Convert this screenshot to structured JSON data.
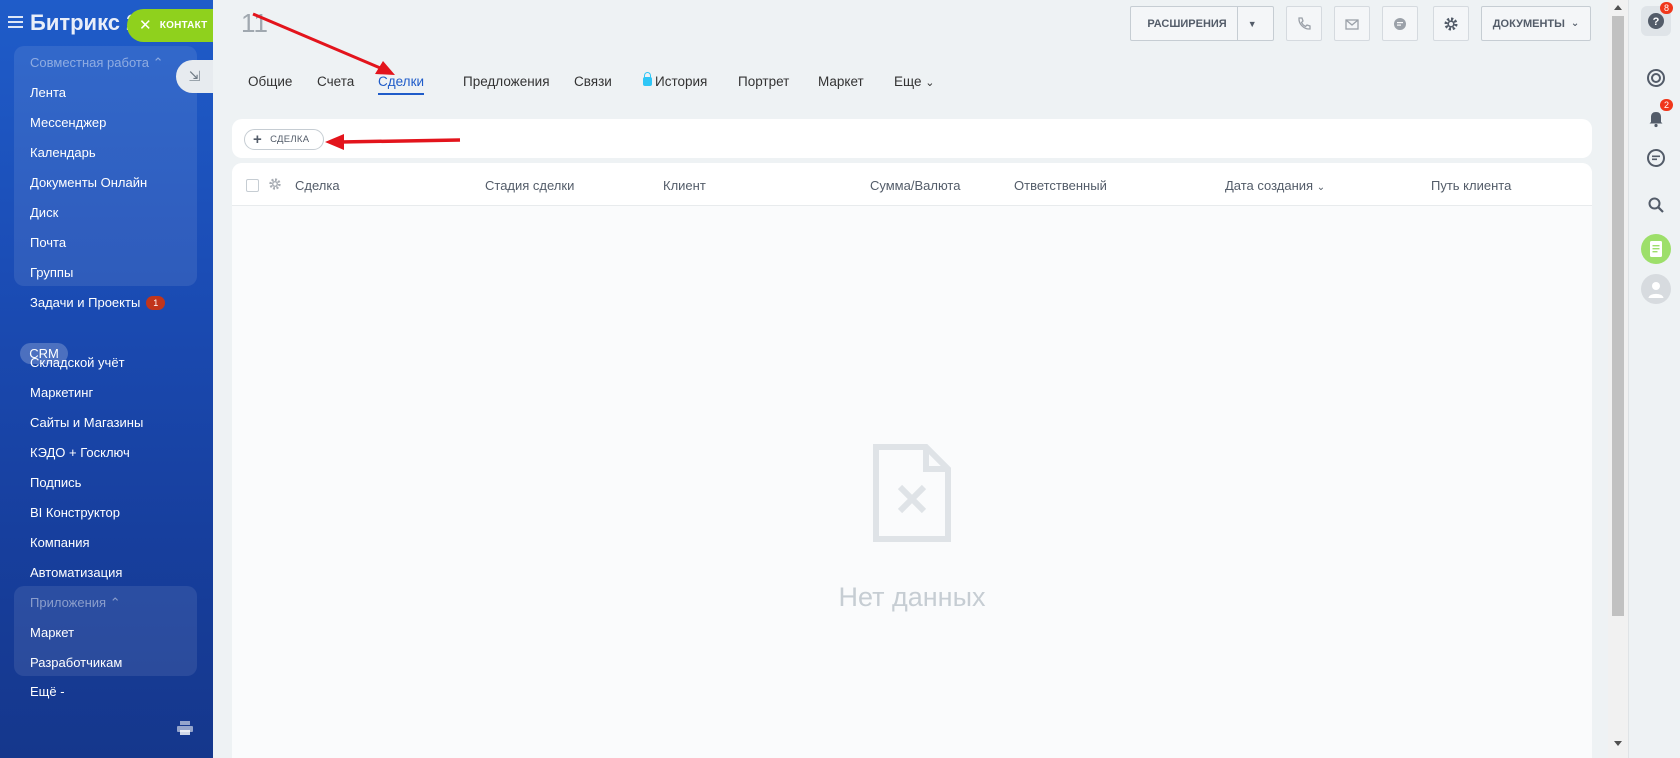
{
  "sidebar": {
    "logo": "Битрикс 24",
    "contact_button": "КОНТАКТ",
    "group1_title": "Совместная работа",
    "group1_items": [
      "Лента",
      "Мессенджер",
      "Календарь",
      "Документы Онлайн",
      "Диск",
      "Почта",
      "Группы"
    ],
    "tasks": "Задачи и Проекты",
    "tasks_badge": "1",
    "crm": "CRM",
    "items": [
      "Складской учёт",
      "Маркетинг",
      "Сайты и Магазины",
      "КЭДО + Госключ",
      "Подпись",
      "BI Конструктор",
      "Компания",
      "Автоматизация"
    ],
    "group2_title": "Приложения",
    "group2_items": [
      "Маркет",
      "Разработчикам"
    ],
    "more": "Ещё -"
  },
  "header": {
    "title": "11",
    "extensions": "РАСШИРЕНИЯ",
    "documents": "ДОКУМЕНТЫ"
  },
  "tabs": [
    {
      "label": "Общие"
    },
    {
      "label": "Счета"
    },
    {
      "label": "Сделки",
      "active": true
    },
    {
      "label": "Предложения"
    },
    {
      "label": "Связи"
    },
    {
      "label": "История",
      "locked": true
    },
    {
      "label": "Портрет"
    },
    {
      "label": "Маркет"
    },
    {
      "label": "Еще"
    }
  ],
  "toolbar": {
    "add_deal": "СДЕЛКА"
  },
  "grid": {
    "columns": [
      "Сделка",
      "Стадия сделки",
      "Клиент",
      "Сумма/Валюта",
      "Ответственный",
      "Дата создания",
      "Путь клиента"
    ],
    "empty_text": "Нет данных"
  },
  "right_rail": {
    "help_badge": "8",
    "notifications_badge": "2"
  },
  "colors": {
    "sidebar": "#1b4db6",
    "accent": "#1f5cc9",
    "contact_green": "#8fd11d",
    "annotation_red": "#e3141c"
  }
}
